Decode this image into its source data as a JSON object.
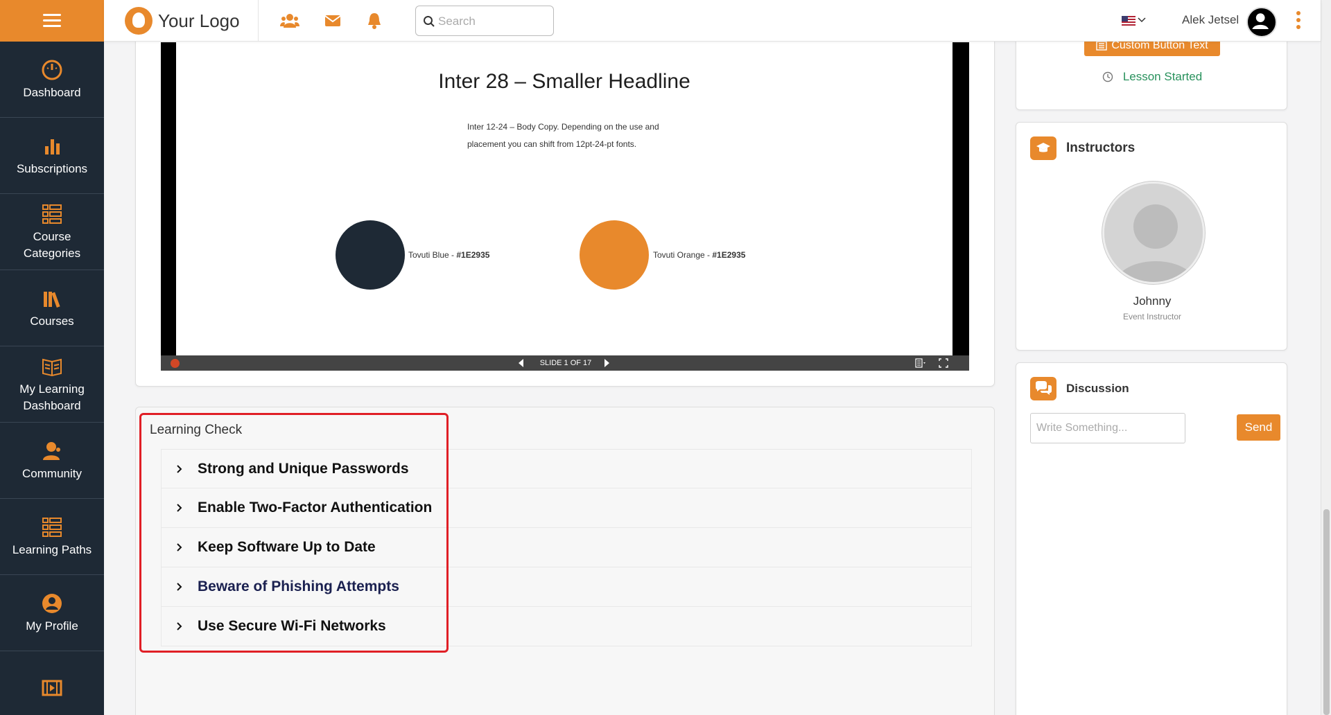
{
  "header": {
    "logo_text": "Your Logo",
    "search_placeholder": "Search",
    "user_name": "Alek Jetsel"
  },
  "sidebar": {
    "items": [
      {
        "label": "Dashboard"
      },
      {
        "label": "Subscriptions"
      },
      {
        "label": "Course Categories"
      },
      {
        "label": "Courses"
      },
      {
        "label": "My Learning Dashboard"
      },
      {
        "label": "Community"
      },
      {
        "label": "Learning Paths"
      },
      {
        "label": "My Profile"
      }
    ]
  },
  "slide": {
    "title": "Inter 28 – Smaller Headline",
    "body": "Inter 12-24 – Body Copy. Depending on the use and placement you can shift from 12pt-24-pt fonts.",
    "swatch1_label_prefix": "Tovuti Blue - ",
    "swatch1_label_code": "#1E2935",
    "swatch2_label_prefix": "Tovuti Orange - ",
    "swatch2_label_code": "#1E2935",
    "counter": "SLIDE 1 OF 17",
    "swatch_colors": {
      "blue": "#1e2935",
      "orange": "#e8892c"
    }
  },
  "learning_check": {
    "title": "Learning Check",
    "items": [
      {
        "label": "Strong and Unique Passwords"
      },
      {
        "label": "Enable Two-Factor Authentication"
      },
      {
        "label": "Keep Software Up to Date"
      },
      {
        "label": "Beware of Phishing Attempts"
      },
      {
        "label": "Use Secure Wi-Fi Networks"
      }
    ]
  },
  "lesson": {
    "button_label": "Custom Button Text",
    "status": "Lesson Started"
  },
  "instructors": {
    "title": "Instructors",
    "name": "Johnny",
    "role": "Event Instructor"
  },
  "discussion": {
    "title": "Discussion",
    "placeholder": "Write Something...",
    "send_label": "Send"
  },
  "colors": {
    "accent": "#e8892c",
    "sidebar": "#1e2935",
    "status_green": "#28915c",
    "highlight_red": "#e01f26"
  }
}
